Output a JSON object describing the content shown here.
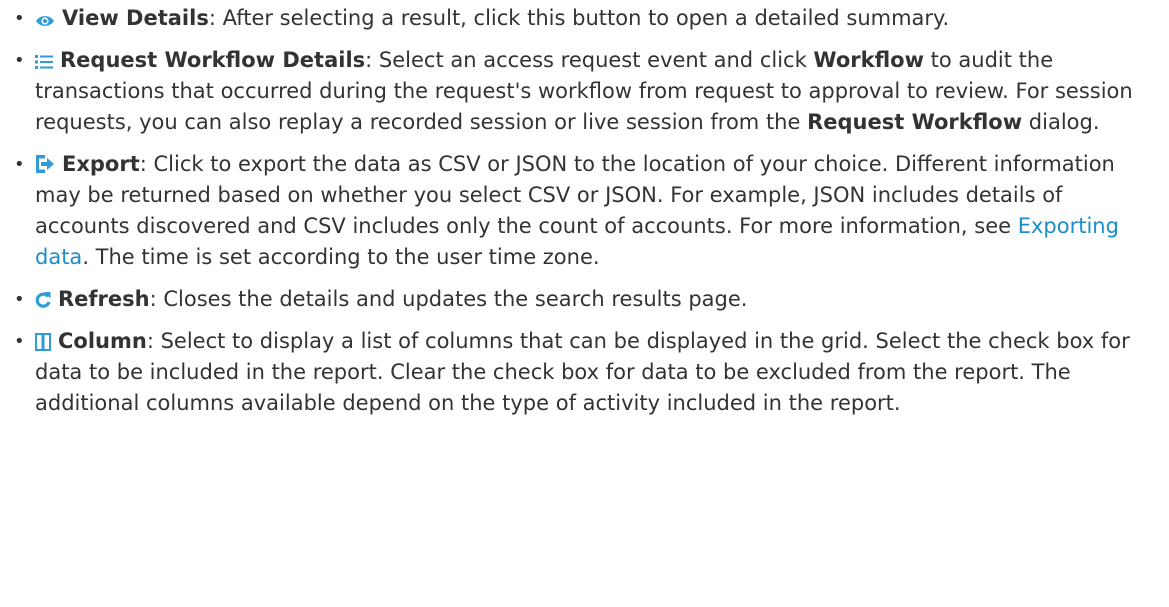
{
  "colors": {
    "icon_blue": "#2f9bd8",
    "link": "#1a8fc9",
    "text": "#333333"
  },
  "items": [
    {
      "icon": "eye-icon",
      "title": "View Details",
      "text": ": After selecting a result, click this button to open a detailed summary."
    },
    {
      "icon": "list-icon",
      "title": "Request Workflow Details",
      "text1": ": Select an access request event and click ",
      "bold1": "Workflow",
      "text2": " to audit the transactions that occurred during the request's workflow from request to approval to review. For session requests, you can also replay a recorded session or live session from the ",
      "bold2": "Request Workflow",
      "text3": " dialog."
    },
    {
      "icon": "export-icon",
      "title": "Export",
      "text1": ": Click to export the data as CSV or JSON to the location of your choice. Different information may be returned based on whether you select CSV or JSON. For example, JSON includes details of accounts discovered and CSV includes only the count of accounts. For more information, see ",
      "link": "Exporting data",
      "text2": ". The time is set according to the user time zone."
    },
    {
      "icon": "refresh-icon",
      "title": "Refresh",
      "text": ": Closes the details and updates the search results page."
    },
    {
      "icon": "column-icon",
      "title": "Column",
      "text": ": Select to display a list of columns that can be displayed in the grid. Select the check box for data to be included in the report. Clear the check box for data to be excluded from the report. The additional columns available depend on the type of activity included in the report."
    }
  ]
}
